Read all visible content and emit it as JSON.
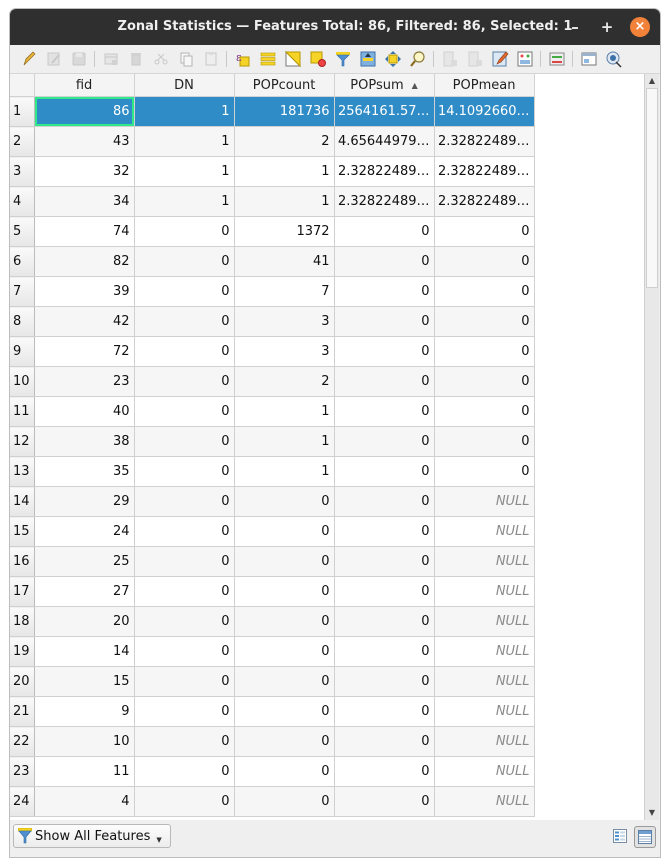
{
  "window": {
    "title": "Zonal Statistics — Features Total: 86, Filtered: 86, Selected: 1",
    "minimize_label": "–",
    "maximize_label": "+",
    "close_label": "×"
  },
  "toolbar": {
    "icons": [
      "toggle-editing-icon",
      "multi-edit-icon",
      "save-edits-icon",
      "sep",
      "add-feature-icon",
      "delete-feature-icon",
      "cut-icon",
      "copy-icon",
      "paste-icon",
      "sep",
      "select-by-expression-icon",
      "select-all-icon",
      "invert-selection-icon",
      "deselect-all-icon",
      "filter-selected-icon",
      "move-selection-top-icon",
      "pan-to-selection-icon",
      "zoom-to-selection-icon",
      "sep",
      "new-field-icon",
      "delete-field-icon",
      "field-calculator-icon",
      "conditional-formatting-icon",
      "sep",
      "actions-icon",
      "sep",
      "dock-icon",
      "identify-icon"
    ]
  },
  "table": {
    "columns": [
      "fid",
      "DN",
      "POPcount",
      "POPsum",
      "POPmean"
    ],
    "sorted_column": "POPsum",
    "sort_direction": "ascending",
    "sort_indicator": "▲",
    "selected_row": 1,
    "rows": [
      {
        "n": "1",
        "cells": [
          "86",
          "1",
          "181736",
          "2564161.57…",
          "14.1092660…"
        ]
      },
      {
        "n": "2",
        "cells": [
          "43",
          "1",
          "2",
          "4.65644979…",
          "2.32822489…"
        ]
      },
      {
        "n": "3",
        "cells": [
          "32",
          "1",
          "1",
          "2.32822489…",
          "2.32822489…"
        ]
      },
      {
        "n": "4",
        "cells": [
          "34",
          "1",
          "1",
          "2.32822489…",
          "2.32822489…"
        ]
      },
      {
        "n": "5",
        "cells": [
          "74",
          "0",
          "1372",
          "0",
          "0"
        ]
      },
      {
        "n": "6",
        "cells": [
          "82",
          "0",
          "41",
          "0",
          "0"
        ]
      },
      {
        "n": "7",
        "cells": [
          "39",
          "0",
          "7",
          "0",
          "0"
        ]
      },
      {
        "n": "8",
        "cells": [
          "42",
          "0",
          "3",
          "0",
          "0"
        ]
      },
      {
        "n": "9",
        "cells": [
          "72",
          "0",
          "3",
          "0",
          "0"
        ]
      },
      {
        "n": "10",
        "cells": [
          "23",
          "0",
          "2",
          "0",
          "0"
        ]
      },
      {
        "n": "11",
        "cells": [
          "40",
          "0",
          "1",
          "0",
          "0"
        ]
      },
      {
        "n": "12",
        "cells": [
          "38",
          "0",
          "1",
          "0",
          "0"
        ]
      },
      {
        "n": "13",
        "cells": [
          "35",
          "0",
          "1",
          "0",
          "0"
        ]
      },
      {
        "n": "14",
        "cells": [
          "29",
          "0",
          "0",
          "0",
          "NULL"
        ]
      },
      {
        "n": "15",
        "cells": [
          "24",
          "0",
          "0",
          "0",
          "NULL"
        ]
      },
      {
        "n": "16",
        "cells": [
          "25",
          "0",
          "0",
          "0",
          "NULL"
        ]
      },
      {
        "n": "17",
        "cells": [
          "27",
          "0",
          "0",
          "0",
          "NULL"
        ]
      },
      {
        "n": "18",
        "cells": [
          "20",
          "0",
          "0",
          "0",
          "NULL"
        ]
      },
      {
        "n": "19",
        "cells": [
          "14",
          "0",
          "0",
          "0",
          "NULL"
        ]
      },
      {
        "n": "20",
        "cells": [
          "15",
          "0",
          "0",
          "0",
          "NULL"
        ]
      },
      {
        "n": "21",
        "cells": [
          "9",
          "0",
          "0",
          "0",
          "NULL"
        ]
      },
      {
        "n": "22",
        "cells": [
          "10",
          "0",
          "0",
          "0",
          "NULL"
        ]
      },
      {
        "n": "23",
        "cells": [
          "11",
          "0",
          "0",
          "0",
          "NULL"
        ]
      },
      {
        "n": "24",
        "cells": [
          "4",
          "0",
          "0",
          "0",
          "NULL"
        ]
      }
    ]
  },
  "bottom": {
    "filter_button_label": "Show All Features",
    "form_view_label": "Switch to form view",
    "table_view_label": "Switch to table view"
  },
  "colors": {
    "selection": "#308cc6",
    "focus_border": "#2ee88a",
    "titlebar": "#2f2f2f",
    "close_button": "#f2813a"
  }
}
